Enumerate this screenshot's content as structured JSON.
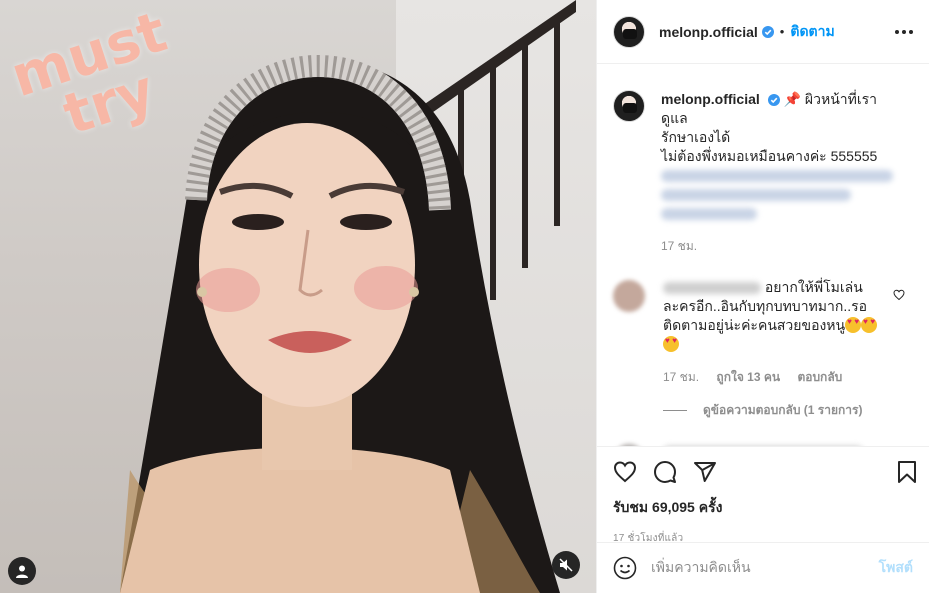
{
  "post": {
    "username": "melonp.official",
    "separator": "•",
    "follow_label": "ติดตาม",
    "more_label": "more-options"
  },
  "caption": {
    "username": "melonp.official",
    "line1": "📌 ผิวหน้าที่เราดูแล",
    "line2": "รักษาเองได้",
    "line3": "ไม่ต้องพึ่งหมอเหมือนคางค่ะ 555555",
    "time": "17 ชม."
  },
  "comment1": {
    "text_l1": "อยากให้พี่โมเล่น",
    "text_l2": "ละครอีก..อินกับทุกบทบาทมาก..รอ",
    "text_l3": "ติดตามอยู่น่ะค่ะคนสวยของหนู",
    "time": "17 ชม.",
    "likes": "ถูกใจ 13 คน",
    "reply": "ตอบกลับ",
    "view_replies": "ดูข้อความตอบกลับ (1 รายการ)"
  },
  "stats": {
    "likes": "รับชม 69,095 ครั้ง",
    "time_ago": "17 ชั่วโมงที่แล้ว"
  },
  "add_comment": {
    "placeholder": "เพิ่มความคิดเห็น",
    "post_label": "โพสต์"
  },
  "media": {
    "sticker_line1": "must",
    "sticker_line2": "try"
  },
  "colors": {
    "accent": "#0095f6",
    "verified": "#3897f0",
    "muted": "#8e8e8e",
    "post_disabled": "#b2dffc"
  }
}
